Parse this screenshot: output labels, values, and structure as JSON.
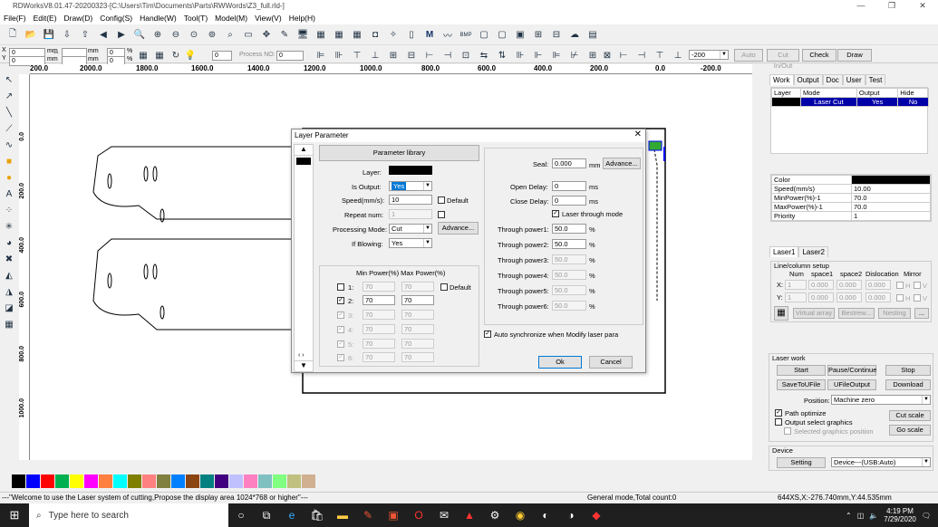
{
  "window": {
    "title": "RDWorksV8.01.47-20200323-[C:\\Users\\Tim\\Documents\\Parts\\RWWords\\Z3_full.rld-]"
  },
  "menu": [
    "File(F)",
    "Edit(E)",
    "Draw(D)",
    "Config(S)",
    "Handle(W)",
    "Tool(T)",
    "Model(M)",
    "View(V)",
    "Help(H)"
  ],
  "toolbar2": {
    "x_val": "0",
    "y_val": "0",
    "mm1": "mm",
    "mm2": "mm",
    "w_val": "0",
    "h_val": "0",
    "pct1": "%",
    "pct2": "%",
    "angle": "0",
    "process_no_label": "Process NO:",
    "process_no": "0",
    "auto_label": "Auto",
    "cut_inout_label": "Cut In/Out",
    "check_label": "Check",
    "draw_label": "Draw",
    "combo": "-200"
  },
  "ruler_top": [
    "200.0",
    "2000.0",
    "1800.0",
    "1600.0",
    "1400.0",
    "1200.0",
    "1000.0",
    "800.0",
    "600.0",
    "400.0",
    "200.0",
    "0.0",
    "-200.0"
  ],
  "ruler_left": [
    "0.0",
    "200.0",
    "400.0",
    "600.0",
    "800.0",
    "1000.0"
  ],
  "dialog": {
    "title": "Layer Parameter",
    "param_library": "Parameter library",
    "layer_label": "Layer:",
    "is_output_label": "Is Output:",
    "is_output_value": "Yes",
    "speed_label": "Speed(mm/s):",
    "speed_value": "10",
    "default_label": "Default",
    "repeat_label": "Repeat num:",
    "repeat_value": "1",
    "processing_label": "Processing Mode:",
    "processing_value": "Cut",
    "advance_label": "Advance...",
    "blowing_label": "If Blowing:",
    "blowing_value": "Yes",
    "power_header": "Min Power(%) Max Power(%)",
    "power_default": "Default",
    "powers": [
      {
        "n": "1:",
        "min": "70",
        "max": "70"
      },
      {
        "n": "2:",
        "min": "70",
        "max": "70"
      },
      {
        "n": "3:",
        "min": "70",
        "max": "70"
      },
      {
        "n": "4:",
        "min": "70",
        "max": "70"
      },
      {
        "n": "5:",
        "min": "70",
        "max": "70"
      },
      {
        "n": "6:",
        "min": "70",
        "max": "70"
      }
    ],
    "seal_label": "Seal:",
    "seal_value": "0.000",
    "seal_unit": "mm",
    "seal_advance": "Advance...",
    "open_delay_label": "Open Delay:",
    "open_delay_value": "0",
    "ms": "ms",
    "close_delay_label": "Close Delay:",
    "close_delay_value": "0",
    "laser_through_label": "Laser through mode",
    "through": [
      {
        "label": "Through power1:",
        "value": "50.0"
      },
      {
        "label": "Through power2:",
        "value": "50.0"
      },
      {
        "label": "Through power3:",
        "value": "50.0"
      },
      {
        "label": "Through power4:",
        "value": "50.0"
      },
      {
        "label": "Through power5:",
        "value": "50.0"
      },
      {
        "label": "Through power6:",
        "value": "50.0"
      }
    ],
    "pct": "%",
    "auto_sync_label": "Auto synchronize when Modify laser para",
    "ok_label": "Ok",
    "cancel_label": "Cancel"
  },
  "right_panel": {
    "tabs": [
      "Work",
      "Output",
      "Doc",
      "User",
      "Test"
    ],
    "layer_headers": [
      "Layer",
      "Mode",
      "Output",
      "Hide"
    ],
    "layer_row": {
      "mode": "Laser Cut",
      "output": "Yes",
      "hide": "No"
    },
    "props": [
      {
        "k": "Color",
        "v": ""
      },
      {
        "k": "Speed(mm/s)",
        "v": "10.00"
      },
      {
        "k": "MinPower(%)-1",
        "v": "70.0"
      },
      {
        "k": "MaxPower(%)-1",
        "v": "70.0"
      },
      {
        "k": "Priority",
        "v": "1"
      }
    ],
    "laser_tabs": [
      "Laser1",
      "Laser2"
    ],
    "line_col_title": "Line/column setup",
    "lc_headers": [
      "Num",
      "space1",
      "space2",
      "Dislocation",
      "Mirror"
    ],
    "lc_x": {
      "label": "X:",
      "num": "1",
      "s1": "0.000",
      "s2": "0.000",
      "dis": "0.000",
      "h": "H",
      "v": "V"
    },
    "lc_y": {
      "label": "Y:",
      "num": "1",
      "s1": "0.000",
      "s2": "0.000",
      "dis": "0.000",
      "h": "H",
      "v": "V"
    },
    "virtual_array": "Virtual array",
    "bestrew": "Bestrew...",
    "nesting": "Nesting",
    "more": "...",
    "laser_work_title": "Laser work",
    "start": "Start",
    "pause": "Pause/Continue",
    "stop": "Stop",
    "save_to_ufile": "SaveToUFile",
    "ufile_output": "UFileOutput",
    "download": "Download",
    "position_label": "Position:",
    "position_value": "Machine zero",
    "path_optimize": "Path optimize",
    "output_select": "Output select graphics",
    "selected_area": "Selected graphics position",
    "cut_scale": "Cut scale",
    "go_scale": "Go scale",
    "device_title": "Device",
    "setting": "Setting",
    "device_value": "Device---(USB:Auto)"
  },
  "palette": [
    "#000000",
    "#0000ff",
    "#ff0000",
    "#00b050",
    "#ffff00",
    "#ff00ff",
    "#ff8040",
    "#00ffff",
    "#808000",
    "#ff8080",
    "#808040",
    "#0080ff",
    "#8b4513",
    "#008080",
    "#400080",
    "#c0c0ff",
    "#ff80c0",
    "#80c0c0",
    "#80ff80",
    "#c0c080",
    "#d0b090"
  ],
  "status": {
    "message": "---\"Welcome to use the Laser system of cutting,Propose the display area 1024*768 or higher\"---",
    "mode": "General mode,Total count:0",
    "coords": "644XS,X:-276.740mm,Y:44.535mm"
  },
  "taskbar": {
    "search_placeholder": "Type here to search",
    "time": "4:19 PM",
    "date": "7/29/2020"
  }
}
